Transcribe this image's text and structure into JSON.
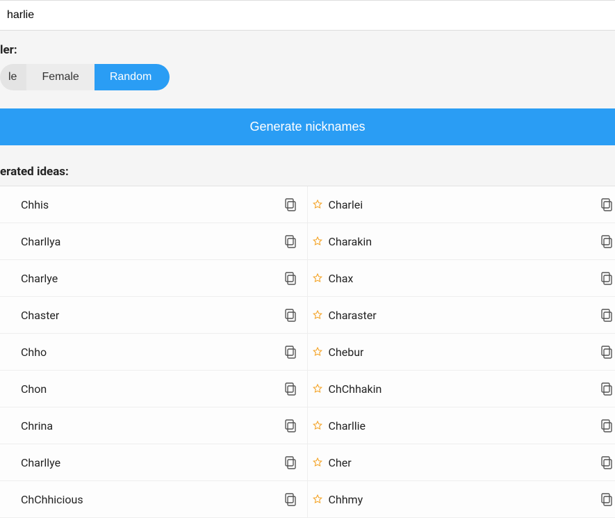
{
  "input": {
    "value": "harlie"
  },
  "gender": {
    "label": "ler:",
    "options": [
      "le",
      "Female",
      "Random"
    ],
    "active": "Random"
  },
  "generate_button": "Generate nicknames",
  "ideas": {
    "label": "erated ideas:",
    "left": [
      "Chhis",
      "Charllya",
      "Charlye",
      "Chaster",
      "Chho",
      "Chon",
      "Chrina",
      "Charllye",
      "ChChhicious"
    ],
    "right": [
      "Charlei",
      "Charakin",
      "Chax",
      "Charaster",
      "Chebur",
      "ChChhakin",
      "Charllie",
      "Cher",
      "Chhmy"
    ]
  }
}
